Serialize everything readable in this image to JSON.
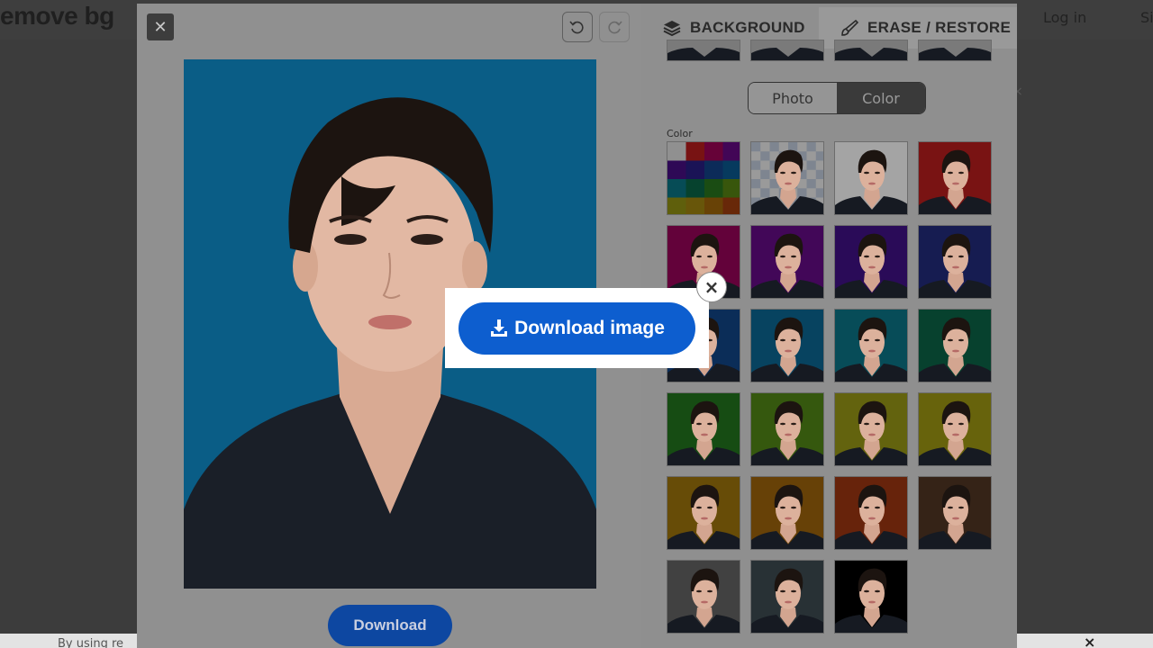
{
  "site": {
    "logo_text": "emove bg",
    "login_label": "Log in",
    "signup_label": "Si",
    "cookie_text": "By using re",
    "cookie_close": "×",
    "side_close": "×"
  },
  "editor": {
    "close_label": "✕",
    "download_label": "Download",
    "tabs": {
      "background_label": "BACKGROUND",
      "erase_label": "ERASE / RESTORE"
    },
    "toggle": {
      "photo_label": "Photo",
      "color_label": "Color",
      "selected": "Color"
    },
    "section_label": "Color",
    "photo_background": "#0a5d86",
    "swatches": [
      "palette",
      "transparent",
      "#e4e4e4",
      "#a81a1a",
      "#8a0350",
      "#5c0a7a",
      "#3a0f7a",
      "#1e2770",
      "#0f3f7a",
      "#0a5d86",
      "#0a6a7a",
      "#0a5a40",
      "#1f6a1a",
      "#4a7a14",
      "#8a8a14",
      "#8f8a10",
      "#8f6a0a",
      "#8f5a0a",
      "#8f300f",
      "#4a3020",
      "#5a5a5a",
      "#38444a",
      "#000000"
    ],
    "top_strip_count": 4
  },
  "popup": {
    "download_image_label": "Download image",
    "close_label": "×"
  },
  "colors": {
    "accent": "#0d5ecf",
    "download_button": "#0d47a1"
  }
}
